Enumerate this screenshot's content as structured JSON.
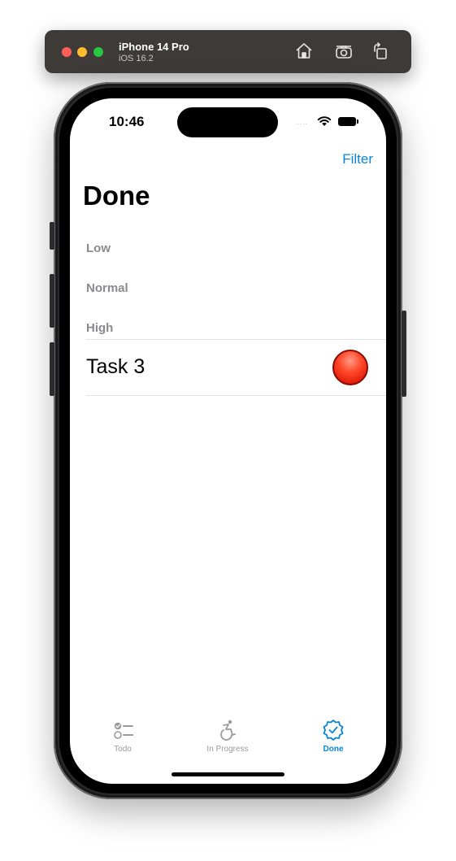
{
  "simulator": {
    "device_name": "iPhone 14 Pro",
    "os_version": "iOS 16.2",
    "toolbar_icons": [
      "home-icon",
      "screenshot-icon",
      "rotate-icon"
    ]
  },
  "status_bar": {
    "time": "10:46",
    "signal": "....",
    "icons": [
      "wifi-icon",
      "battery-icon"
    ]
  },
  "nav": {
    "filter_label": "Filter",
    "title": "Done"
  },
  "list": {
    "sections": [
      {
        "header": "Low",
        "items": []
      },
      {
        "header": "Normal",
        "items": []
      },
      {
        "header": "High",
        "items": [
          {
            "title": "Task 3",
            "priority_color": "#e8240e"
          }
        ]
      }
    ]
  },
  "tab_bar": {
    "tabs": [
      {
        "label": "Todo",
        "icon": "checklist-icon",
        "selected": false
      },
      {
        "label": "In Progress",
        "icon": "accessibility-icon",
        "selected": false
      },
      {
        "label": "Done",
        "icon": "checkmark-seal-icon",
        "selected": true
      }
    ]
  },
  "colors": {
    "accent": "#0a84d6",
    "section_header": "#8a8a8e",
    "inactive_tab": "#9a9a9e"
  }
}
